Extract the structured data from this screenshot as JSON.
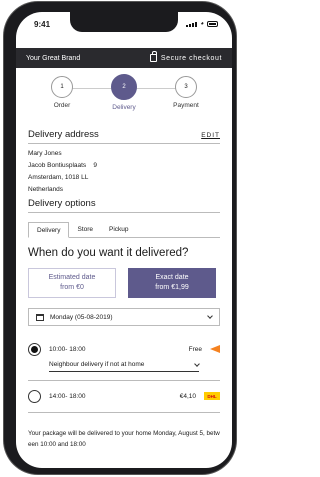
{
  "status": {
    "time": "9:41"
  },
  "brand": {
    "name": "Your Great Brand",
    "secure": "Secure checkout"
  },
  "steps": [
    {
      "number": "1",
      "label": "Order"
    },
    {
      "number": "2",
      "label": "Delivery"
    },
    {
      "number": "3",
      "label": "Payment"
    }
  ],
  "address": {
    "title": "Delivery address",
    "edit": "EDIT",
    "name": "Mary Jones",
    "street": "Jacob Bontiusplaats",
    "number": "9",
    "city": "Amsterdam, 1018 LL",
    "country": "Netherlands"
  },
  "options": {
    "title": "Delivery  options",
    "tabs": [
      "Delivery",
      "Store",
      "Pickup"
    ],
    "question": "When do  you want it delivered?",
    "estimated": {
      "line1": "Estimated date",
      "line2": "from €0"
    },
    "exact": {
      "line1": "Exact date",
      "line2": "from €1,99"
    },
    "date": "Monday (05-08-2019)",
    "slot1": {
      "time": "10:00- 18:00",
      "price": "Free",
      "neighbour": "Neighbour  delivery  if not at home"
    },
    "slot2": {
      "time": "14:00- 18:00",
      "price": "€4,10"
    },
    "dhl": "DHL"
  },
  "note": "Your package  will be delivered to your home Monday, August  5, betw een 10:00  and 18:00"
}
